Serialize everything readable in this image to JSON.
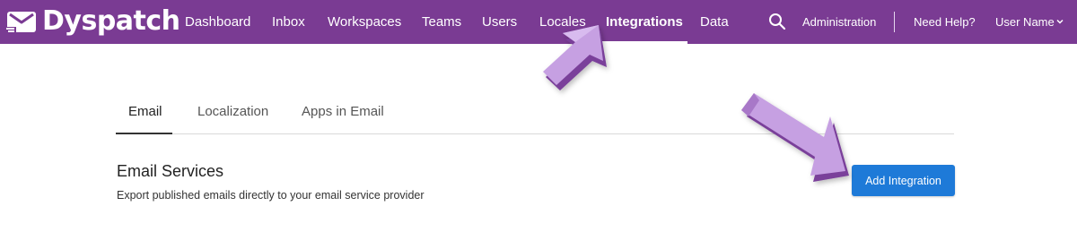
{
  "brand": {
    "name": "Dyspatch"
  },
  "nav": {
    "items": [
      {
        "label": "Dashboard"
      },
      {
        "label": "Inbox"
      },
      {
        "label": "Workspaces"
      },
      {
        "label": "Teams"
      },
      {
        "label": "Users"
      },
      {
        "label": "Locales"
      },
      {
        "label": "Integrations",
        "active": true
      },
      {
        "label": "Data"
      }
    ],
    "administration": "Administration",
    "help": "Need Help?",
    "user": "User Name"
  },
  "tabs": [
    {
      "label": "Email",
      "active": true
    },
    {
      "label": "Localization"
    },
    {
      "label": "Apps in Email"
    }
  ],
  "section": {
    "title": "Email Services",
    "description": "Export published emails directly to your email service provider",
    "add_button": "Add Integration"
  },
  "colors": {
    "topbar": "#7a3b93",
    "primary_button": "#1e7ad8",
    "annotation_arrow": "#c39ae0"
  },
  "icons": {
    "logo": "envelope-logo-icon",
    "search": "search-icon",
    "user_menu": "chevron-down-icon"
  }
}
